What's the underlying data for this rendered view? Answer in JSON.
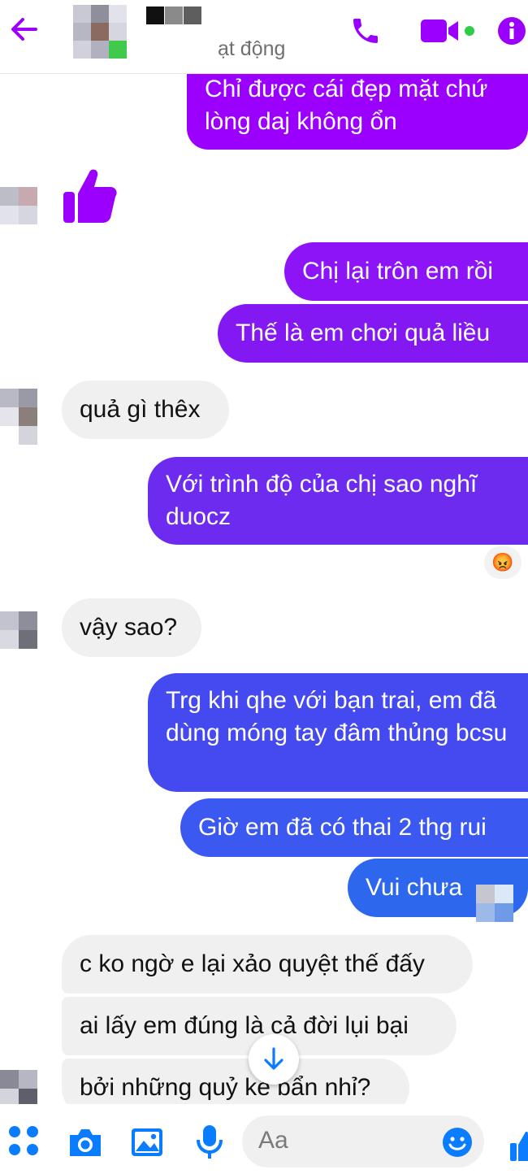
{
  "header": {
    "status": "ạt động",
    "accent": "#9b00ff"
  },
  "messages": [
    {
      "from": "me",
      "text": "Chỉ được cái đẹp mặt chứ lòng daj không ổn"
    },
    {
      "from": "contact",
      "type": "like"
    },
    {
      "from": "me",
      "text": "Chị lại trôn em rồi"
    },
    {
      "from": "me",
      "text": "Thế là em chơi quả liều"
    },
    {
      "from": "contact",
      "text": "quả gì thêx"
    },
    {
      "from": "me",
      "text": "Với trình độ của chị sao nghĩ duocz",
      "reaction": "😡"
    },
    {
      "from": "contact",
      "text": "vậy sao?"
    },
    {
      "from": "me",
      "text": "Trg khi qhe với bạn trai, em đã dùng móng tay đâm thủng bcsu"
    },
    {
      "from": "me",
      "text": "Giờ em đã có thai 2 thg rui"
    },
    {
      "from": "me",
      "text": "Vui chưa"
    },
    {
      "from": "contact",
      "text": "c ko ngờ e lại xảo quyệt thế đấy"
    },
    {
      "from": "contact",
      "text": "ai lấy em đúng là cả đời lụi bại"
    },
    {
      "from": "contact",
      "text": "bởi những quỷ kế bẩn nhỉ?"
    }
  ],
  "composer": {
    "placeholder": "Aa"
  },
  "icons": {
    "back": "arrow-left-icon",
    "call": "phone-icon",
    "video": "video-camera-icon",
    "info": "info-icon",
    "apps": "grid-dots-icon",
    "camera": "camera-icon",
    "gallery": "image-icon",
    "mic": "microphone-icon",
    "emoji": "smiley-icon",
    "like": "thumbs-up-icon",
    "scroll": "arrow-down-icon"
  }
}
